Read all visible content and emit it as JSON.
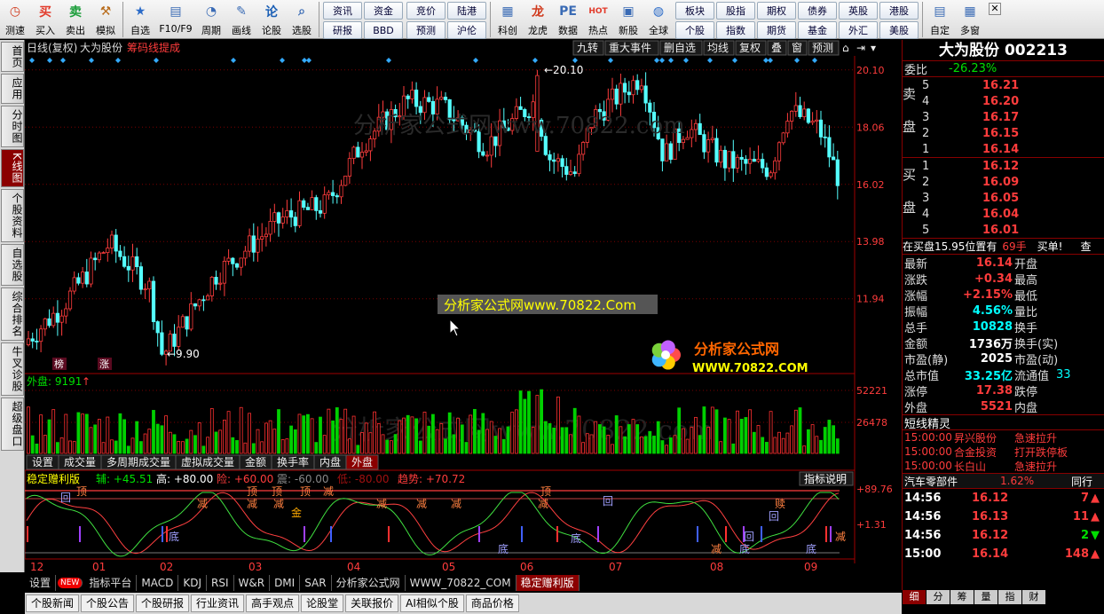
{
  "toolbar": {
    "buttons": [
      {
        "label": "测速",
        "icon": "speed-test-icon",
        "color": "#d0391c",
        "glyph": "◷"
      },
      {
        "label": "买入",
        "icon": "buy-icon",
        "color": "#e23b2b",
        "glyph": "买"
      },
      {
        "label": "卖出",
        "icon": "sell-icon",
        "color": "#1b9d3a",
        "glyph": "卖"
      },
      {
        "label": "模拟",
        "icon": "hammer-icon",
        "color": "#b86b1a",
        "glyph": "⚒"
      },
      {
        "label": "自选",
        "icon": "star-icon",
        "color": "#2b6bc8",
        "glyph": "★"
      },
      {
        "label": "F10/F9",
        "icon": "f10-icon",
        "color": "#3a6bb5",
        "glyph": "▤"
      },
      {
        "label": "周期",
        "icon": "clock-icon",
        "color": "#3a6bb5",
        "glyph": "◔"
      },
      {
        "label": "画线",
        "icon": "pencil-icon",
        "color": "#3a6bb5",
        "glyph": "✎"
      },
      {
        "label": "论股",
        "icon": "discuss-icon",
        "color": "#1b5fb5",
        "glyph": "论"
      },
      {
        "label": "选股",
        "icon": "magnifier-icon",
        "color": "#3a6bb5",
        "glyph": "⌕"
      }
    ],
    "mini1": [
      "资讯",
      "资金",
      "研报",
      "BBD"
    ],
    "mini2": [
      "竞价",
      "陆港",
      "预测",
      "沪伦"
    ],
    "buttons2": [
      {
        "label": "科创",
        "icon": "kechuang-icon",
        "color": "#3a6bb5",
        "glyph": "▦"
      },
      {
        "label": "龙虎",
        "icon": "dragon-icon",
        "color": "#d0391c",
        "glyph": "龙"
      },
      {
        "label": "数据",
        "icon": "pe-icon",
        "color": "#3a6bb5",
        "glyph": "PE"
      },
      {
        "label": "热点",
        "icon": "hot-icon",
        "color": "#e23b2b",
        "glyph": "HOT"
      },
      {
        "label": "新股",
        "icon": "new-stock-icon",
        "color": "#3a6bb5",
        "glyph": "▣"
      },
      {
        "label": "全球",
        "icon": "globe-icon",
        "color": "#2b6bc8",
        "glyph": "◍"
      }
    ],
    "mini3": [
      "板块",
      "股指",
      "期权",
      "债券",
      "英股",
      "港股",
      "个股",
      "指数",
      "期货",
      "基金",
      "外汇",
      "美股"
    ],
    "buttons3": [
      {
        "label": "自定",
        "icon": "custom-icon",
        "color": "#3a6bb5",
        "glyph": "▤"
      },
      {
        "label": "多窗",
        "icon": "multi-window-icon",
        "color": "#3a6bb5",
        "glyph": "▦"
      }
    ]
  },
  "left_tabs": [
    "首页",
    "应用",
    "分时图",
    "K线图",
    "个股资料",
    "自选股",
    "综合排名",
    "牛叉诊股",
    "超级盘口"
  ],
  "chart_header": {
    "period": "日线(复权)",
    "stock": "大为股份",
    "indicator": "筹码线提成"
  },
  "chart_top_buttons": [
    "九转",
    "重大事件",
    "删自选",
    "均线",
    "复权",
    "叠",
    "窗",
    "预测"
  ],
  "price_axis": [
    "20.10",
    "18.06",
    "16.02",
    "13.98",
    "11.94"
  ],
  "price_marks": {
    "high": "20.10",
    "low": "9.90"
  },
  "kline_badges": [
    "榜",
    "涨"
  ],
  "watermark": "分析家公式网www.70822.com",
  "watermark_box": "分析家公式网www.70822.Com",
  "logo": {
    "line1": "分析家公式网",
    "line2": "WWW.70822.COM"
  },
  "volume": {
    "label": "外盘: 9191",
    "axis": [
      "52221",
      "26478"
    ]
  },
  "mid_tabs": [
    "设置",
    "成交量",
    "多周期成交量",
    "虚拟成交量",
    "金额",
    "换手率",
    "内盘",
    "外盘"
  ],
  "indicator": {
    "name": "稳定赠利版",
    "vals": [
      {
        "k": "辅:",
        "v": "+45.51",
        "c": "#00e000"
      },
      {
        "k": "高:",
        "v": "+80.00",
        "c": "#fff"
      },
      {
        "k": "险:",
        "v": "+60.00",
        "c": "#ff3c3c"
      },
      {
        "k": "震:",
        "v": "-60.00",
        "c": "#888"
      },
      {
        "k": "低:",
        "v": "-80.00",
        "c": "#a01010"
      },
      {
        "k": "趋势:",
        "v": "+70.72",
        "c": "#ff3c3c"
      }
    ],
    "help": "指标说明",
    "axis": [
      "+89.76",
      "+1.31"
    ],
    "markers": [
      "回",
      "顶",
      "顶",
      "顶",
      "顶",
      "减",
      "减",
      "减",
      "减",
      "减",
      "减",
      "减",
      "减",
      "赎",
      "底",
      "底",
      "底",
      "回",
      "回",
      "金",
      "回",
      "减",
      "底",
      "顶",
      "底",
      "减"
    ]
  },
  "x_axis": [
    "12",
    "01",
    "02",
    "03",
    "04",
    "05",
    "06",
    "07",
    "08",
    "09"
  ],
  "bottom_tabs": [
    "设置",
    "NEW",
    "指标平台",
    "MACD",
    "KDJ",
    "RSI",
    "W&R",
    "DMI",
    "SAR",
    "分析家公式网",
    "WWW_70822_COM",
    "稳定赠利版"
  ],
  "bottom2": [
    "个股新闻",
    "个股公告",
    "个股研报",
    "行业资讯",
    "高手观点",
    "论股堂",
    "关联报价",
    "AI相似个股",
    "商品价格"
  ],
  "quote": {
    "title": "大为股份 002213",
    "weibi_label": "委比",
    "weibi": "-26.23%",
    "sell_label": "卖盘",
    "buy_label": "买盘",
    "sell": [
      {
        "n": "5",
        "p": "16.21"
      },
      {
        "n": "4",
        "p": "16.20"
      },
      {
        "n": "3",
        "p": "16.17"
      },
      {
        "n": "2",
        "p": "16.15"
      },
      {
        "n": "1",
        "p": "16.14"
      }
    ],
    "buy": [
      {
        "n": "1",
        "p": "16.12"
      },
      {
        "n": "2",
        "p": "16.09"
      },
      {
        "n": "3",
        "p": "16.05"
      },
      {
        "n": "4",
        "p": "16.04"
      },
      {
        "n": "5",
        "p": "16.01"
      }
    ],
    "notice": "在买盘15.95位置有",
    "notice_v": "69手",
    "notice_b": "买单!",
    "notice_c": "查",
    "stats": [
      {
        "k": "最新",
        "v": "16.14",
        "c": "#ff3c3c",
        "k2": "开盘"
      },
      {
        "k": "涨跌",
        "v": "+0.34",
        "c": "#ff3c3c",
        "k2": "最高"
      },
      {
        "k": "涨幅",
        "v": "+2.15%",
        "c": "#ff3c3c",
        "k2": "最低"
      },
      {
        "k": "振幅",
        "v": "4.56%",
        "c": "#00ffff",
        "k2": "量比"
      },
      {
        "k": "总手",
        "v": "10828",
        "c": "#00ffff",
        "k2": "换手"
      },
      {
        "k": "金额",
        "v": "1736万",
        "c": "#fff",
        "k2": "换手(实)"
      },
      {
        "k": "市盈(静)",
        "v": "2025",
        "c": "#fff",
        "k2": "市盈(动)"
      },
      {
        "k": "总市值",
        "v": "33.25亿",
        "c": "#00ffff",
        "k2": "流通值",
        "v2": "33"
      },
      {
        "k": "涨停",
        "v": "17.38",
        "c": "#ff3c3c",
        "k2": "跌停"
      },
      {
        "k": "外盘",
        "v": "5521",
        "c": "#ff3c3c",
        "k2": "内盘"
      }
    ],
    "short_title": "短线精灵",
    "short": [
      {
        "t": "15:00:00",
        "n": "昇兴股份",
        "e": "急速拉升"
      },
      {
        "t": "15:00:00",
        "n": "合金投资",
        "e": "打开跌停板"
      },
      {
        "t": "15:00:00",
        "n": "长白山",
        "e": "急速拉升"
      }
    ],
    "sector": "汽车零部件",
    "sector_v": "1.62%",
    "sector_t": "同行",
    "ticks": [
      {
        "t": "14:56",
        "p": "16.12",
        "v": "7",
        "d": "up"
      },
      {
        "t": "14:56",
        "p": "16.13",
        "v": "11",
        "d": "up"
      },
      {
        "t": "14:56",
        "p": "16.12",
        "v": "2",
        "d": "down"
      },
      {
        "t": "15:00",
        "p": "16.14",
        "v": "148",
        "d": "up"
      }
    ],
    "bottom_tabs": [
      "细",
      "分",
      "筹",
      "量",
      "指",
      "财"
    ]
  },
  "colors": {
    "up": "#ff3c3c",
    "down": "#54ffff",
    "vol_up": "#ff3030",
    "vol_down": "#00d000",
    "grid": "#7a0000"
  }
}
